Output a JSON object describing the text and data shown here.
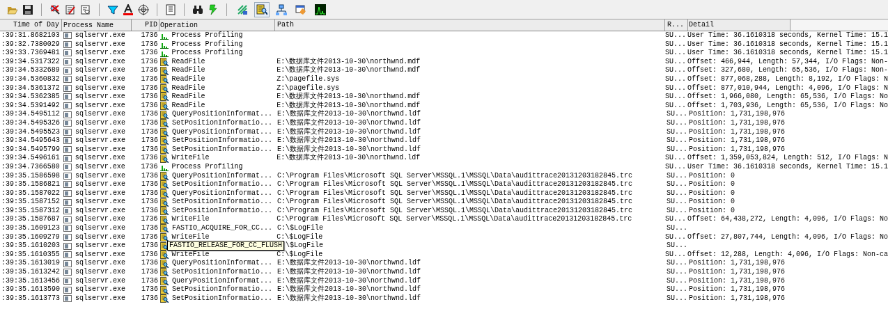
{
  "toolbar": {
    "event_class_toggles": [
      {
        "pressed": false
      },
      {
        "pressed": true
      },
      {
        "pressed": false
      },
      {
        "pressed": false
      },
      {
        "pressed": false
      }
    ]
  },
  "columns": [
    "Time of Day",
    "Process Name",
    "PID",
    "Operation",
    "Path",
    "R...",
    "Detail"
  ],
  "rows": [
    {
      "time": ":39:31.8682103",
      "process": "sqlservr.exe",
      "pid": "1736",
      "kind": "profiling",
      "operation": "Process Profiling",
      "result": "SU...",
      "detail": "User Time: 36.1610318 seconds, Kernel Time: 15.1"
    },
    {
      "time": ":39:32.7380029",
      "process": "sqlservr.exe",
      "pid": "1736",
      "kind": "profiling",
      "operation": "Process Profiling",
      "result": "SU...",
      "detail": "User Time: 36.1610318 seconds, Kernel Time: 15.1"
    },
    {
      "time": ":39:33.7369481",
      "process": "sqlservr.exe",
      "pid": "1736",
      "kind": "profiling",
      "operation": "Process Profiling",
      "result": "SU...",
      "detail": "User Time: 36.1610318 seconds, Kernel Time: 15.1"
    },
    {
      "time": ":39:34.5317322",
      "process": "sqlservr.exe",
      "pid": "1736",
      "kind": "file",
      "operation": "ReadFile",
      "path": "E:\\数据库文件2013-10-30\\northwnd.mdf",
      "result": "SU...",
      "detail": "Offset: 466,944, Length: 57,344, I/O Flags: Non-"
    },
    {
      "time": ":39:34.5332689",
      "process": "sqlservr.exe",
      "pid": "1736",
      "kind": "file",
      "operation": "ReadFile",
      "path": "E:\\数据库文件2013-10-30\\northwnd.mdf",
      "result": "SU...",
      "detail": "Offset: 327,680, Length: 65,536, I/O Flags: Non-"
    },
    {
      "time": ":39:34.5360832",
      "process": "sqlservr.exe",
      "pid": "1736",
      "kind": "file",
      "operation": "ReadFile",
      "path": "Z:\\pagefile.sys",
      "result": "SU...",
      "detail": "Offset: 877,068,288, Length: 8,192, I/O Flags: N"
    },
    {
      "time": ":39:34.5361372",
      "process": "sqlservr.exe",
      "pid": "1736",
      "kind": "file",
      "operation": "ReadFile",
      "path": "Z:\\pagefile.sys",
      "result": "SU...",
      "detail": "Offset: 877,010,944, Length: 4,096, I/O Flags: N"
    },
    {
      "time": ":39:34.5362385",
      "process": "sqlservr.exe",
      "pid": "1736",
      "kind": "file",
      "operation": "ReadFile",
      "path": "E:\\数据库文件2013-10-30\\northwnd.mdf",
      "result": "SU...",
      "detail": "Offset: 1,966,080, Length: 65,536, I/O Flags: No"
    },
    {
      "time": ":39:34.5391492",
      "process": "sqlservr.exe",
      "pid": "1736",
      "kind": "file",
      "operation": "ReadFile",
      "path": "E:\\数据库文件2013-10-30\\northwnd.mdf",
      "result": "SU...",
      "detail": "Offset: 1,703,936, Length: 65,536, I/O Flags: No"
    },
    {
      "time": ":39:34.5495112",
      "process": "sqlservr.exe",
      "pid": "1736",
      "kind": "file",
      "operation": "QueryPositionInformat...",
      "path": "E:\\数据库文件2013-10-30\\northwnd.ldf",
      "result": "SU...",
      "detail": "Position: 1,731,198,976"
    },
    {
      "time": ":39:34.5495326",
      "process": "sqlservr.exe",
      "pid": "1736",
      "kind": "file",
      "operation": "SetPositionInformatio...",
      "path": "E:\\数据库文件2013-10-30\\northwnd.ldf",
      "result": "SU...",
      "detail": "Position: 1,731,198,976"
    },
    {
      "time": ":39:34.5495523",
      "process": "sqlservr.exe",
      "pid": "1736",
      "kind": "file",
      "operation": "QueryPositionInformat...",
      "path": "E:\\数据库文件2013-10-30\\northwnd.ldf",
      "result": "SU...",
      "detail": "Position: 1,731,198,976"
    },
    {
      "time": ":39:34.5495643",
      "process": "sqlservr.exe",
      "pid": "1736",
      "kind": "file",
      "operation": "SetPositionInformatio...",
      "path": "E:\\数据库文件2013-10-30\\northwnd.ldf",
      "result": "SU...",
      "detail": "Position: 1,731,198,976"
    },
    {
      "time": ":39:34.5495799",
      "process": "sqlservr.exe",
      "pid": "1736",
      "kind": "file",
      "operation": "SetPositionInformatio...",
      "path": "E:\\数据库文件2013-10-30\\northwnd.ldf",
      "result": "SU...",
      "detail": "Position: 1,731,198,976"
    },
    {
      "time": ":39:34.5496161",
      "process": "sqlservr.exe",
      "pid": "1736",
      "kind": "file",
      "operation": "WriteFile",
      "path": "E:\\数据库文件2013-10-30\\northwnd.ldf",
      "result": "SU...",
      "detail": "Offset: 1,359,053,824, Length: 512, I/O Flags: N"
    },
    {
      "time": ":39:34.7366580",
      "process": "sqlservr.exe",
      "pid": "1736",
      "kind": "profiling",
      "operation": "Process Profiling",
      "result": "SU...",
      "detail": "User Time: 36.1610318 seconds, Kernel Time: 15.1"
    },
    {
      "time": ":39:35.1586598",
      "process": "sqlservr.exe",
      "pid": "1736",
      "kind": "file",
      "operation": "QueryPositionInformat...",
      "path": "C:\\Program Files\\Microsoft SQL Server\\MSSQL.1\\MSSQL\\Data\\audittrace20131203182845.trc",
      "result": "SU...",
      "detail": "Position: 0"
    },
    {
      "time": ":39:35.1586821",
      "process": "sqlservr.exe",
      "pid": "1736",
      "kind": "file",
      "operation": "SetPositionInformatio...",
      "path": "C:\\Program Files\\Microsoft SQL Server\\MSSQL.1\\MSSQL\\Data\\audittrace20131203182845.trc",
      "result": "SU...",
      "detail": "Position: 0"
    },
    {
      "time": ":39:35.1587022",
      "process": "sqlservr.exe",
      "pid": "1736",
      "kind": "file",
      "operation": "QueryPositionInformat...",
      "path": "C:\\Program Files\\Microsoft SQL Server\\MSSQL.1\\MSSQL\\Data\\audittrace20131203182845.trc",
      "result": "SU...",
      "detail": "Position: 0"
    },
    {
      "time": ":39:35.1587152",
      "process": "sqlservr.exe",
      "pid": "1736",
      "kind": "file",
      "operation": "SetPositionInformatio...",
      "path": "C:\\Program Files\\Microsoft SQL Server\\MSSQL.1\\MSSQL\\Data\\audittrace20131203182845.trc",
      "result": "SU...",
      "detail": "Position: 0"
    },
    {
      "time": ":39:35.1587312",
      "process": "sqlservr.exe",
      "pid": "1736",
      "kind": "file",
      "operation": "SetPositionInformatio...",
      "path": "C:\\Program Files\\Microsoft SQL Server\\MSSQL.1\\MSSQL\\Data\\audittrace20131203182845.trc",
      "result": "SU...",
      "detail": "Position: 0"
    },
    {
      "time": ":39:35.1587687",
      "process": "sqlservr.exe",
      "pid": "1736",
      "kind": "file",
      "operation": "WriteFile",
      "path": "C:\\Program Files\\Microsoft SQL Server\\MSSQL.1\\MSSQL\\Data\\audittrace20131203182845.trc",
      "result": "SU...",
      "detail": "Offset: 64,438,272, Length: 4,096, I/O Flags: No"
    },
    {
      "time": ":39:35.1609123",
      "process": "sqlservr.exe",
      "pid": "1736",
      "kind": "file",
      "operation": "FASTIO_ACQUIRE_FOR_CC...",
      "path": "C:\\$LogFile",
      "result": "SU..."
    },
    {
      "time": ":39:35.1609279",
      "process": "sqlservr.exe",
      "pid": "1736",
      "kind": "file",
      "operation": "WriteFile",
      "path": "C:\\$LogFile",
      "result": "SU...",
      "detail": "Offset: 27,807,744, Length: 4,096, I/O Flags: No"
    },
    {
      "time": ":39:35.1610203",
      "process": "sqlservr.exe",
      "pid": "1736",
      "kind": "file",
      "tooltip": "FASTIO_RELEASE_FOR_CC_FLUSH",
      "path": "\\$LogFile",
      "result": "SU..."
    },
    {
      "time": ":39:35.1610355",
      "process": "sqlservr.exe",
      "pid": "1736",
      "kind": "file",
      "operation": "WriteFile",
      "path": "C:\\$LogFile",
      "result": "SU...",
      "detail": "Offset: 12,288, Length: 4,096, I/O Flags: Non-ca"
    },
    {
      "time": ":39:35.1613019",
      "process": "sqlservr.exe",
      "pid": "1736",
      "kind": "file",
      "operation": "QueryPositionInformat...",
      "path": "E:\\数据库文件2013-10-30\\northwnd.ldf",
      "result": "SU...",
      "detail": "Position: 1,731,198,976"
    },
    {
      "time": ":39:35.1613242",
      "process": "sqlservr.exe",
      "pid": "1736",
      "kind": "file",
      "operation": "SetPositionInformatio...",
      "path": "E:\\数据库文件2013-10-30\\northwnd.ldf",
      "result": "SU...",
      "detail": "Position: 1,731,198,976"
    },
    {
      "time": ":39:35.1613456",
      "process": "sqlservr.exe",
      "pid": "1736",
      "kind": "file",
      "operation": "QueryPositionInformat...",
      "path": "E:\\数据库文件2013-10-30\\northwnd.ldf",
      "result": "SU...",
      "detail": "Position: 1,731,198,976"
    },
    {
      "time": ":39:35.1613590",
      "process": "sqlservr.exe",
      "pid": "1736",
      "kind": "file",
      "operation": "SetPositionInformatio...",
      "path": "E:\\数据库文件2013-10-30\\northwnd.ldf",
      "result": "SU...",
      "detail": "Position: 1,731,198,976"
    },
    {
      "time": ":39:35.1613773",
      "process": "sqlservr.exe",
      "pid": "1736",
      "kind": "file",
      "operation": "SetPositionInformatio...",
      "path": "E:\\数据库文件2013-10-30\\northwnd.ldf",
      "result": "SU...",
      "detail": "Position: 1,731,198,976"
    }
  ]
}
